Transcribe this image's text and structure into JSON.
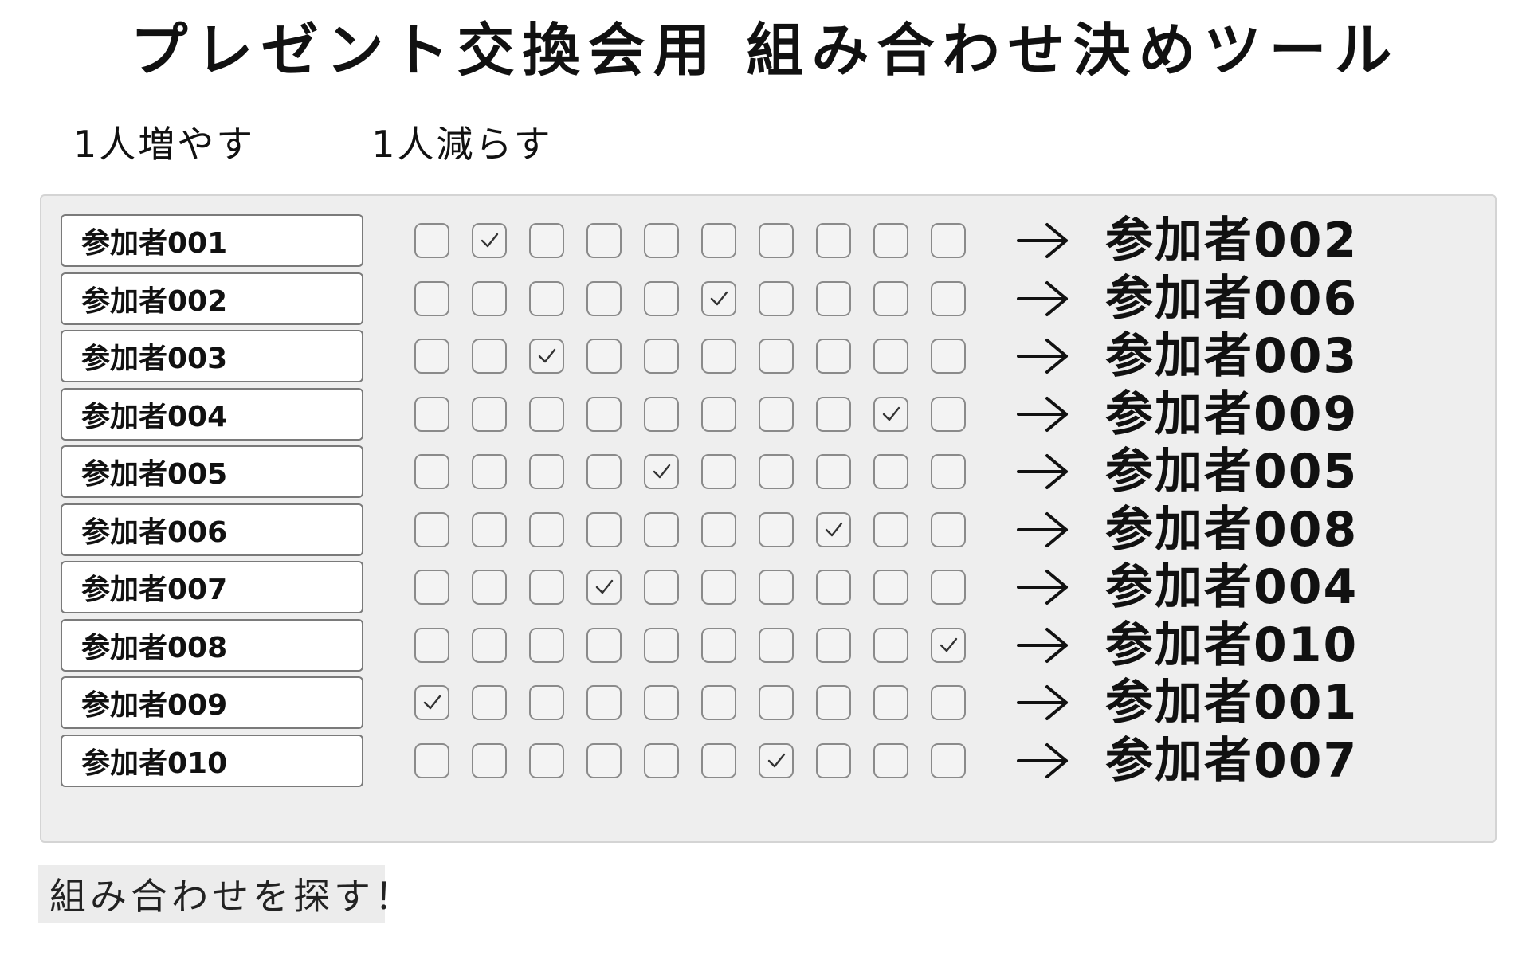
{
  "title": "プレゼント交換会用 組み合わせ決めツール",
  "actions": {
    "add_label": "1人増やす",
    "remove_label": "1人減らす"
  },
  "search_button_label": "組み合わせを探す！",
  "arrow_icon": "right-arrow-icon",
  "check_icon": "checkmark-icon",
  "participants": [
    {
      "name": "参加者001",
      "checked_index": 1,
      "result": "参加者002"
    },
    {
      "name": "参加者002",
      "checked_index": 5,
      "result": "参加者006"
    },
    {
      "name": "参加者003",
      "checked_index": 2,
      "result": "参加者003"
    },
    {
      "name": "参加者004",
      "checked_index": 8,
      "result": "参加者009"
    },
    {
      "name": "参加者005",
      "checked_index": 4,
      "result": "参加者005"
    },
    {
      "name": "参加者006",
      "checked_index": 7,
      "result": "参加者008"
    },
    {
      "name": "参加者007",
      "checked_index": 3,
      "result": "参加者004"
    },
    {
      "name": "参加者008",
      "checked_index": 9,
      "result": "参加者010"
    },
    {
      "name": "参加者009",
      "checked_index": 0,
      "result": "参加者001"
    },
    {
      "name": "参加者010",
      "checked_index": 6,
      "result": "参加者007"
    }
  ]
}
